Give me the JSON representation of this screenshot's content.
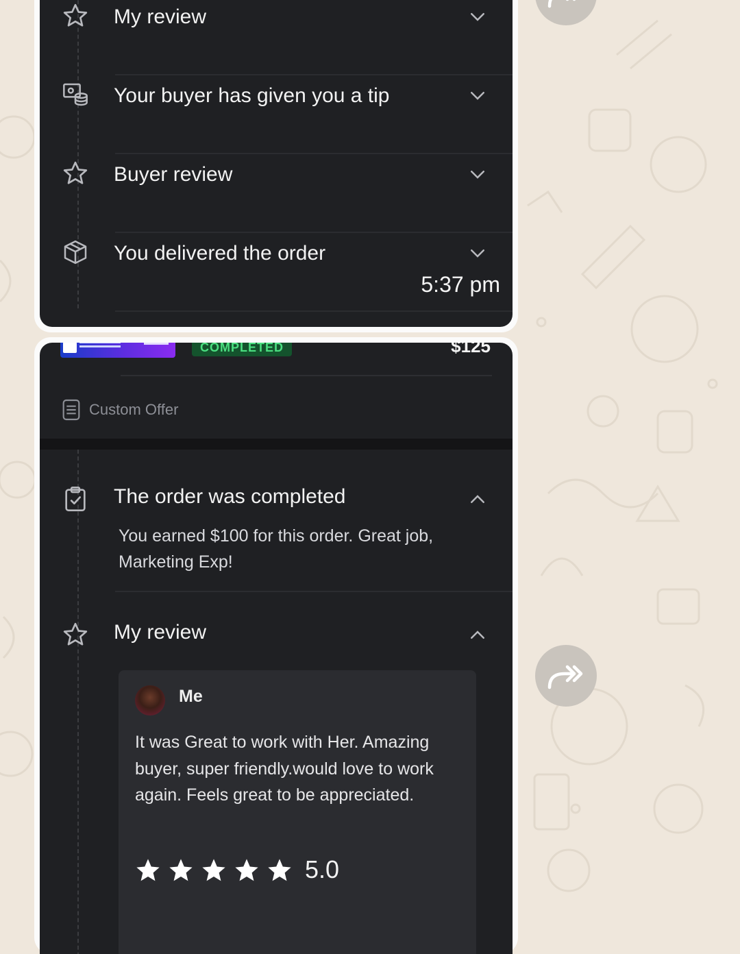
{
  "order_timeline": {
    "rows": [
      {
        "label": "My review",
        "icon": "star-outline-icon"
      },
      {
        "label": "Your buyer has given you a tip",
        "icon": "money-tip-icon"
      },
      {
        "label": "Buyer review",
        "icon": "star-outline-icon"
      },
      {
        "label": "You delivered the order",
        "icon": "package-box-icon"
      }
    ],
    "timestamp": "5:37 pm"
  },
  "order_card": {
    "status": "COMPLETED",
    "price": "$125",
    "custom_offer_label": "Custom Offer",
    "completed_title": "The order was completed",
    "earned_text": "You earned $100 for this order. Great job, Marketing Exp!",
    "my_review_title": "My review",
    "review": {
      "reviewer": "Me",
      "text": "It was Great to work with Her. Amazing buyer, super friendly.would love to work again. Feels great to be appreciated.",
      "rating": 5,
      "rating_label": "5.0"
    }
  },
  "colors": {
    "card_bg": "#1f2023",
    "bubble_bg": "#fbfbfb",
    "status_green": "#4ade80",
    "chat_wallpaper": "#efe7dc",
    "forward_button": "#c9c4bd"
  }
}
